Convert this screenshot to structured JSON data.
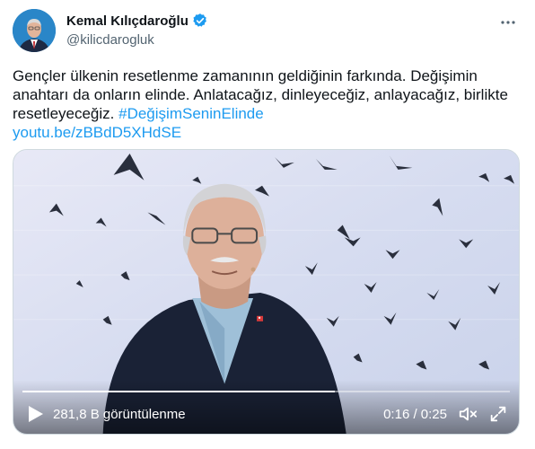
{
  "author": {
    "display_name": "Kemal Kılıçdaroğlu",
    "handle": "@kilicdarogluk",
    "verified": true,
    "verified_color": "#1d9bf0"
  },
  "tweet": {
    "text": "Gençler ülkenin resetlenme zamanının geldiğinin farkında. Değişimin anahtarı da onların elinde. Anlatacağız, dinleyeceğiz, anlayacağız, birlikte resetleyeceğiz.",
    "hashtag": "#DeğişimSeninElinde",
    "link": "youtu.be/zBBdD5XHdSE",
    "link_color": "#1d9bf0"
  },
  "video": {
    "views": "281,8 B görüntülenme",
    "time": "0:16 / 0:25",
    "progress": 0.64
  },
  "icons": {
    "more": "more-horizontal-icon",
    "play": "play-icon",
    "mute": "volume-muted-icon",
    "fullscreen": "fullscreen-icon",
    "verified": "verified-badge-icon"
  }
}
